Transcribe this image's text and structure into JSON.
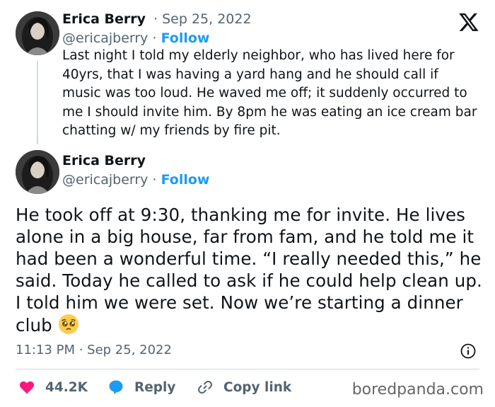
{
  "tweet1": {
    "author_name": "Erica Berry",
    "separator": "·",
    "date": "Sep 25, 2022",
    "handle": "@ericajberry",
    "follow_label": "Follow",
    "text": "Last night I told my elderly neighbor, who has lived here for 40yrs, that I was having a yard hang and he should call if music was too loud. He waved me off; it suddenly occurred to me I should invite him. By 8pm he was eating an ice cream bar chatting w/ my friends by fire pit."
  },
  "tweet2": {
    "author_name": "Erica Berry",
    "handle": "@ericajberry",
    "separator": "·",
    "follow_label": "Follow",
    "text": "He took off at 9:30, thanking me for invite. He lives alone in a big house, far from fam, and he told me it had been a wonderful time. “I really needed this,” he said. Today he called to ask if he could help clean up. I told him we were set. Now we’re starting a dinner club",
    "emoji": "pleading-face",
    "timestamp": "11:13 PM · Sep 25, 2022"
  },
  "actions": {
    "like_count": "44.2K",
    "reply_label": "Reply",
    "copy_link_label": "Copy link"
  },
  "watermark": "boredpanda.com",
  "colors": {
    "link_blue": "#1d9bf0",
    "like_red": "#f91880",
    "secondary_text": "#536471"
  }
}
